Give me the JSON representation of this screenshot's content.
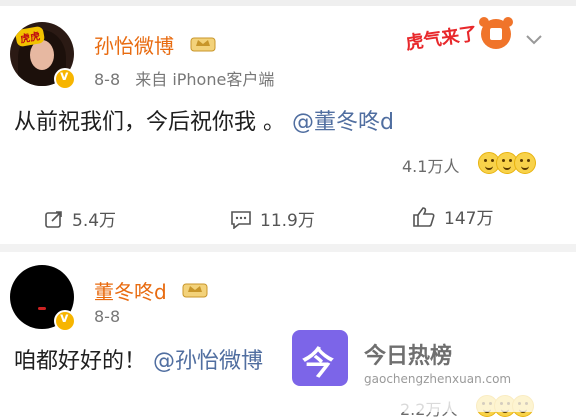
{
  "post1": {
    "author": "孙怡微博",
    "date": "8-8",
    "source": "来自 iPhone客户端",
    "text_prefix": "从前祝我们，今后祝你我 。",
    "mention": "@董冬咚d",
    "likes": "4.1万人",
    "actions": {
      "repost": "5.4万",
      "comment": "11.9万",
      "like": "147万"
    },
    "avatar_badge": "虎虎"
  },
  "post2": {
    "author": "董冬咚d",
    "date": "8-8",
    "text_prefix": "咱都好好的！",
    "mention": "@孙怡微博",
    "likes": "2.2万人"
  },
  "sticker_text": "虎气来了",
  "watermark": {
    "title": "今日热榜",
    "url": "gaochengzhenxuan.com",
    "glyph": "今"
  },
  "colors": {
    "name_orange": "#e86b10",
    "mention_blue": "#506ea0",
    "badge_gold": "#f7b500"
  }
}
